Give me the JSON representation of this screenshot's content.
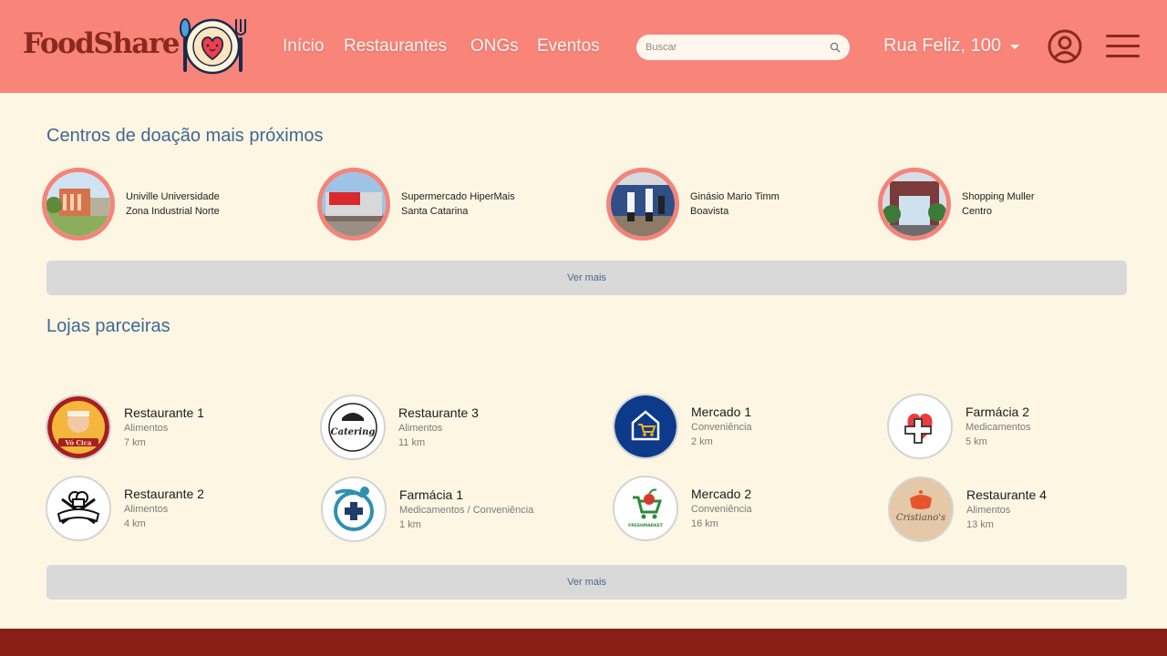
{
  "brand": {
    "name": "FoodShare",
    "logo_icon": "heart-plate-icon"
  },
  "nav": [
    "Início",
    "Restaurantes",
    "ONGs",
    "Eventos"
  ],
  "search": {
    "placeholder": "Buscar",
    "icon": "search-icon"
  },
  "address": "Rua Feliz, 100",
  "colors": {
    "header": "#f9847a",
    "brand_dark": "#8a2a1c",
    "background": "#fdf6e3",
    "footer": "#8a1f17",
    "title": "#3f6894",
    "button": "#d9d9d9"
  },
  "donation": {
    "title": "Centros de doação mais próximos",
    "more_label": "Ver mais",
    "items": [
      {
        "name": "Univille Universidade",
        "area": "Zona Industrial Norte"
      },
      {
        "name": "Supermercado HiperMais",
        "area": "Santa Catarina"
      },
      {
        "name": "Ginásio Mario Timm",
        "area": "Boavista"
      },
      {
        "name": "Shopping Muller",
        "area": "Centro"
      }
    ]
  },
  "stores": {
    "title": "Lojas parceiras",
    "more_label": "Ver mais",
    "items": [
      {
        "name": "Restaurante 1",
        "category": "Alimentos",
        "distance": "7 km",
        "logo_text": "Vó Cica"
      },
      {
        "name": "Restaurante 3",
        "category": "Alimentos",
        "distance": "11 km",
        "logo_text": "Catering"
      },
      {
        "name": "Mercado 1",
        "category": "Conveniência",
        "distance": "2 km"
      },
      {
        "name": "Farmácia 2",
        "category": "Medicamentos",
        "distance": "5 km"
      },
      {
        "name": "Restaurante 2",
        "category": "Alimentos",
        "distance": "4 km"
      },
      {
        "name": "Farmácia 1",
        "category": "Medicamentos / Conveniência",
        "distance": "1 km"
      },
      {
        "name": "Mercado 2",
        "category": "Conveniência",
        "distance": "16 km",
        "logo_text": "FRESHMARKET"
      },
      {
        "name": "Restaurante 4",
        "category": "Alimentos",
        "distance": "13 km",
        "logo_text": "Cristiano's"
      }
    ]
  }
}
